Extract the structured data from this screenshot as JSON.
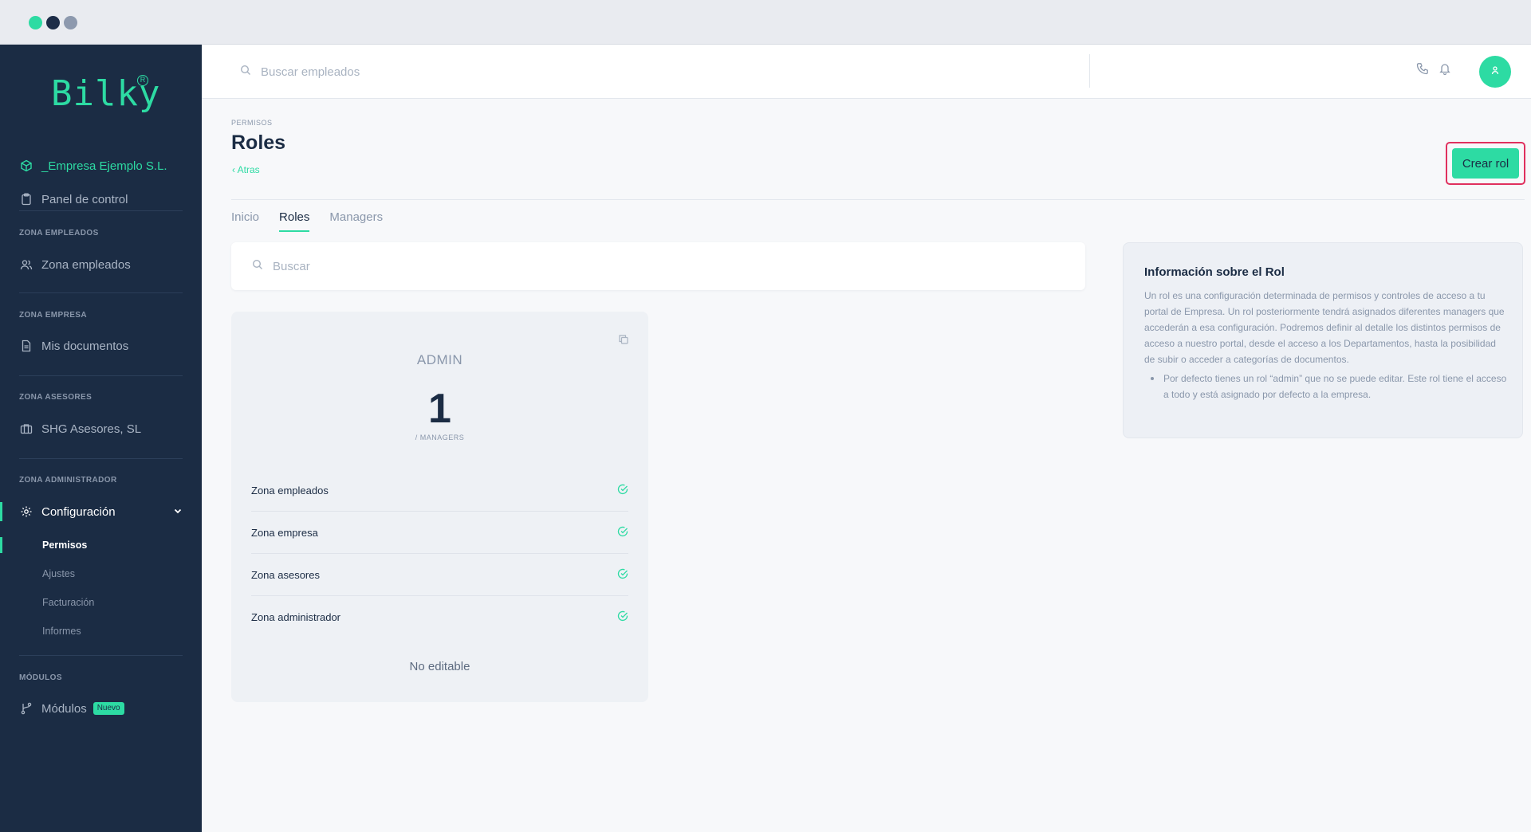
{
  "sidebar": {
    "logo": "Bilky",
    "logo_mark": "R",
    "company": "_Empresa Ejemplo S.L.",
    "dashboard": "Panel de control",
    "sections": {
      "employees": "ZONA EMPLEADOS",
      "company": "ZONA EMPRESA",
      "advisors": "ZONA ASESORES",
      "admin": "ZONA ADMINISTRADOR",
      "modules": "MÓDULOS"
    },
    "items": {
      "employees": "Zona empleados",
      "documents": "Mis documentos",
      "advisors": "SHG Asesores, SL",
      "config": "Configuración",
      "modules": "Módulos",
      "modules_badge": "Nuevo"
    },
    "config_sub": [
      "Permisos",
      "Ajustes",
      "Facturación",
      "Informes"
    ]
  },
  "topbar": {
    "search_placeholder": "Buscar empleados"
  },
  "page": {
    "eyebrow": "PERMISOS",
    "title": "Roles",
    "back": "Atras",
    "create_button": "Crear rol",
    "tabs": [
      "Inicio",
      "Roles",
      "Managers"
    ],
    "active_tab": "Roles",
    "search_placeholder": "Buscar"
  },
  "role_card": {
    "name": "ADMIN",
    "count": "1",
    "count_label": "/ MANAGERS",
    "permissions": [
      "Zona empleados",
      "Zona empresa",
      "Zona asesores",
      "Zona administrador"
    ],
    "footer": "No editable"
  },
  "info": {
    "title": "Información sobre el Rol",
    "body": "Un rol es una configuración determinada de permisos y controles de acceso a tu portal de Empresa. Un rol posteriormente tendrá asignados diferentes managers que accederán a esa configuración. Podremos definir al detalle los distintos permisos de acceso a nuestro portal, desde el acceso a los Departamentos, hasta la posibilidad de subir o acceder a categorías de documentos.",
    "bullet": "Por defecto tienes un rol “admin” que no se puede editar. Este rol tiene el acceso a todo y está asignado por defecto a la empresa."
  },
  "colors": {
    "accent": "#2ddba3",
    "sidebar_bg": "#1b2c44",
    "highlight": "#e0305e"
  }
}
